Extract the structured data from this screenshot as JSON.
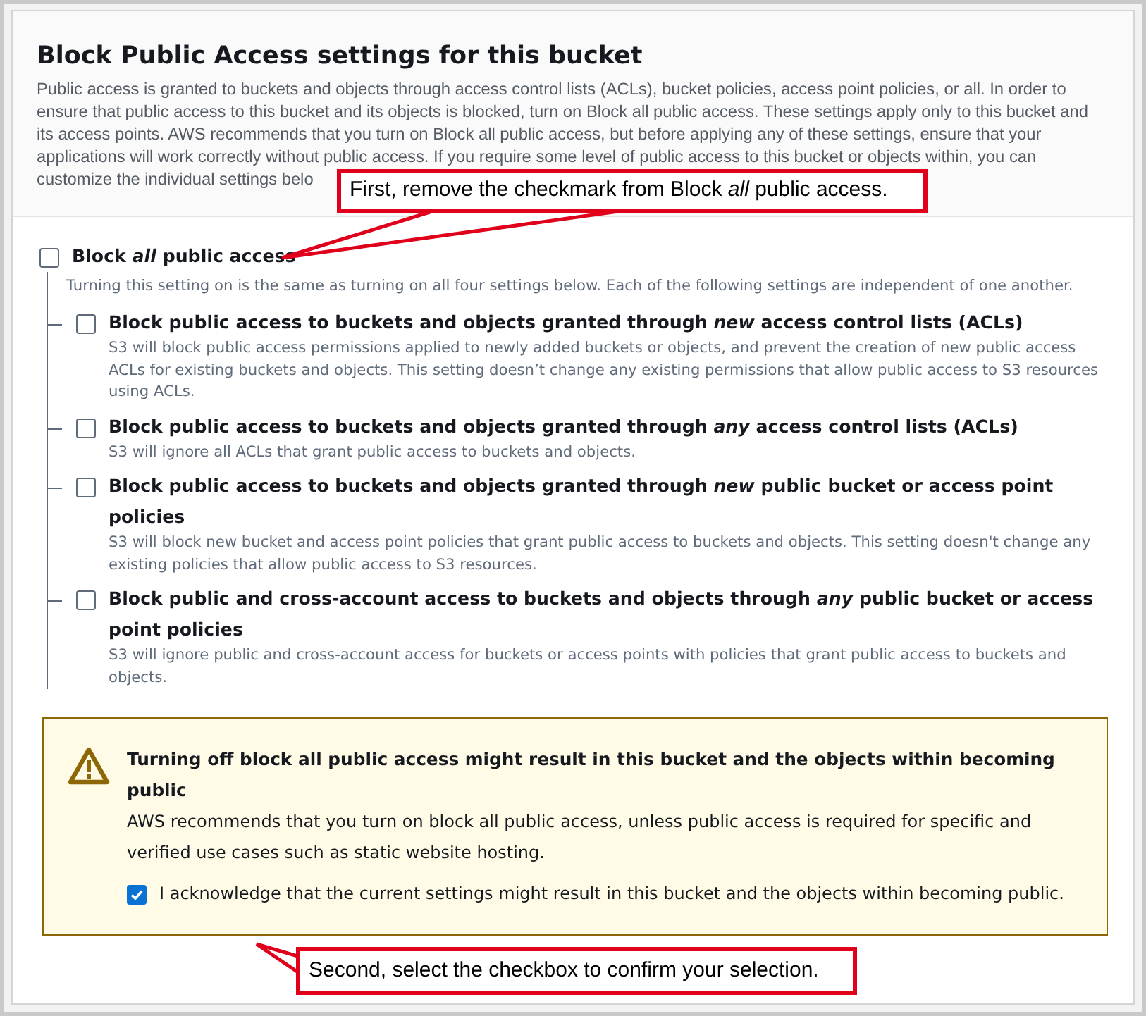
{
  "section": {
    "title": "Block Public Access settings for this bucket",
    "description": "Public access is granted to buckets and objects through access control lists (ACLs), bucket policies, access point policies, or all. In order to ensure that public access to this bucket and its objects is blocked, turn on Block all public access. These settings apply only to this bucket and its access points. AWS recommends that you turn on Block all public access, but before applying any of these settings, ensure that your applications will work correctly without public access. If you require some level of public access to this bucket or objects within, you can",
    "description_tail": "customize the individual settings belo"
  },
  "block_all": {
    "label": "Block *all* public access",
    "checked": false,
    "description": "Turning this setting on is the same as turning on all four settings below. Each of the following settings are independent of one another."
  },
  "settings": [
    {
      "label": "Block public access to buckets and objects granted through *new* access control lists (ACLs)",
      "checked": false,
      "description": "S3 will block public access permissions applied to newly added buckets or objects, and prevent the creation of new public access ACLs for existing buckets and objects. This setting doesn’t change any existing permissions that allow public access to S3 resources using ACLs."
    },
    {
      "label": "Block public access to buckets and objects granted through *any* access control lists (ACLs)",
      "checked": false,
      "description": "S3 will ignore all ACLs that grant public access to buckets and objects."
    },
    {
      "label": "Block public access to buckets and objects granted through *new* public bucket or access point policies",
      "checked": false,
      "description": "S3 will block new bucket and access point policies that grant public access to buckets and objects. This setting doesn't change any existing policies that allow public access to S3 resources."
    },
    {
      "label": "Block public and cross-account access to buckets and objects through *any* public bucket or access point policies",
      "checked": false,
      "description": "S3 will ignore public and cross-account access for buckets or access points with policies that grant public access to buckets and objects."
    }
  ],
  "warning": {
    "title": "Turning off block all public access might result in this bucket and the objects within becoming public",
    "message": "AWS recommends that you turn on block all public access, unless public access is required for specific and verified use cases such as static website hosting.",
    "acknowledge": {
      "label": "I acknowledge that the current settings might result in this bucket and the objects within becoming public.",
      "checked": true
    }
  },
  "callouts": [
    {
      "text": "First, remove the checkmark from Block *all* public access."
    },
    {
      "text": "Second, select the checkbox to confirm your selection."
    }
  ]
}
